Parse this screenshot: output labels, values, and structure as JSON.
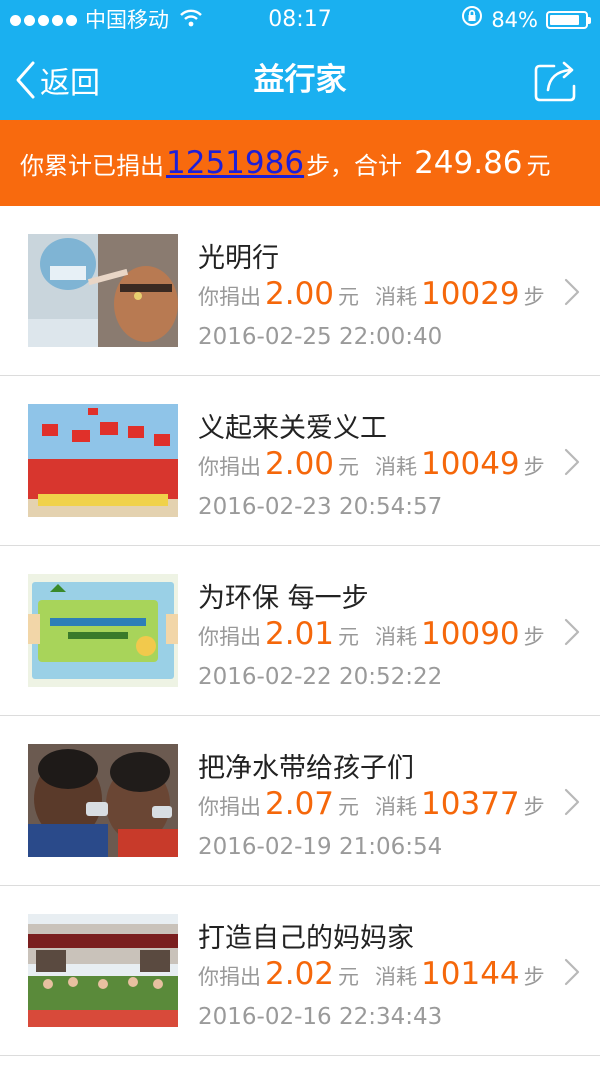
{
  "status_bar": {
    "carrier": "中国移动",
    "time": "08:17",
    "battery": "84%",
    "battery_level": 0.84
  },
  "nav": {
    "back_label": "返回",
    "title": "益行家"
  },
  "summary": {
    "prefix": "你累计已捐出",
    "steps": "1251986",
    "steps_suffix": "步，合计",
    "amount": "249.86",
    "amount_suffix": "元"
  },
  "labels": {
    "donated": "你捐出",
    "yuan": "元",
    "consumed": "消耗",
    "step": "步"
  },
  "donations": [
    {
      "title": "光明行",
      "amount": "2.00",
      "steps": "10029",
      "date": "2016-02-25 22:00:40"
    },
    {
      "title": "义起来关爱义工",
      "amount": "2.00",
      "steps": "10049",
      "date": "2016-02-23 20:54:57"
    },
    {
      "title": "为环保 每一步",
      "amount": "2.01",
      "steps": "10090",
      "date": "2016-02-22 20:52:22"
    },
    {
      "title": "把净水带给孩子们",
      "amount": "2.07",
      "steps": "10377",
      "date": "2016-02-19 21:06:54"
    },
    {
      "title": "打造自己的妈妈家",
      "amount": "2.02",
      "steps": "10144",
      "date": "2016-02-16 22:34:43"
    }
  ],
  "colors": {
    "header_bg": "#1ab0f0",
    "banner_bg": "#f86a0e",
    "accent_orange": "#f5670a",
    "link_blue": "#1d1fd8"
  },
  "icons": {
    "back": "chevron-left-icon",
    "share": "share-icon",
    "row_arrow": "chevron-right-icon",
    "wifi": "wifi-icon",
    "battery": "battery-icon",
    "orientation_lock": "orientation-lock-icon"
  }
}
